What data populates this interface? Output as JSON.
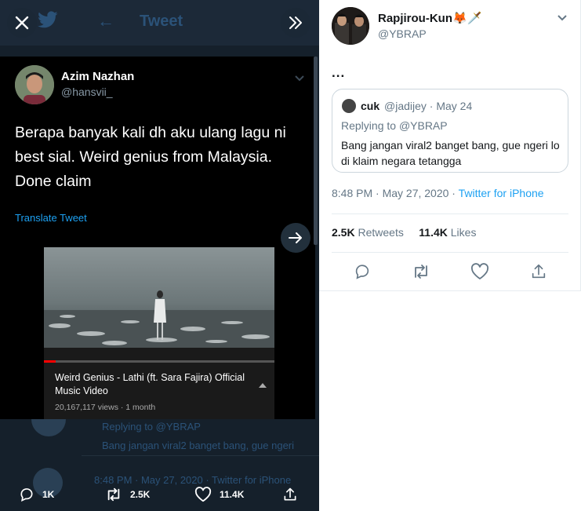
{
  "viewer": {
    "background_header_title": "Tweet",
    "background_reply_to": "Replying to @YBRAP",
    "background_reply_text": "Bang jangan viral2 banget bang, gue ngeri",
    "background_timestamp": "8:48 PM · May 27, 2020 · Twitter for iPhone",
    "tweet": {
      "author_name": "Azim Nazhan",
      "author_handle": "@hansvii_",
      "text": "Berapa banyak kali dh aku ulang lagu ni best sial. Weird genius from Malaysia. Done claim",
      "translate_label": "Translate Tweet"
    },
    "video": {
      "title": "Weird Genius - Lathi (ft. Sara Fajira) Official Music Video",
      "views": "20,167,117 views · 1 month",
      "progress": 0.05
    },
    "actions": {
      "replies": "1K",
      "retweets": "2.5K",
      "likes": "11.4K"
    }
  },
  "detail": {
    "author_name": "Rapjirou-Kun",
    "author_emoji": "🦊🗡️",
    "author_handle": "@YBRAP",
    "text": "...",
    "quote": {
      "name": "cuk",
      "handle_date": "@jadijey · May 24",
      "replying_label": "Replying to",
      "replying_handle": "@YBRAP",
      "text": "Bang jangan viral2 banget bang, gue ngeri lo di klaim negara tetangga"
    },
    "timestamp": "8:48 PM · May 27, 2020 · ",
    "source": "Twitter for iPhone",
    "retweets_count": "2.5K",
    "retweets_label": "Retweets",
    "likes_count": "11.4K",
    "likes_label": "Likes"
  },
  "colors": {
    "accent": "#1da1f2",
    "dark_bg": "#15202b",
    "card_bg": "#000000"
  }
}
